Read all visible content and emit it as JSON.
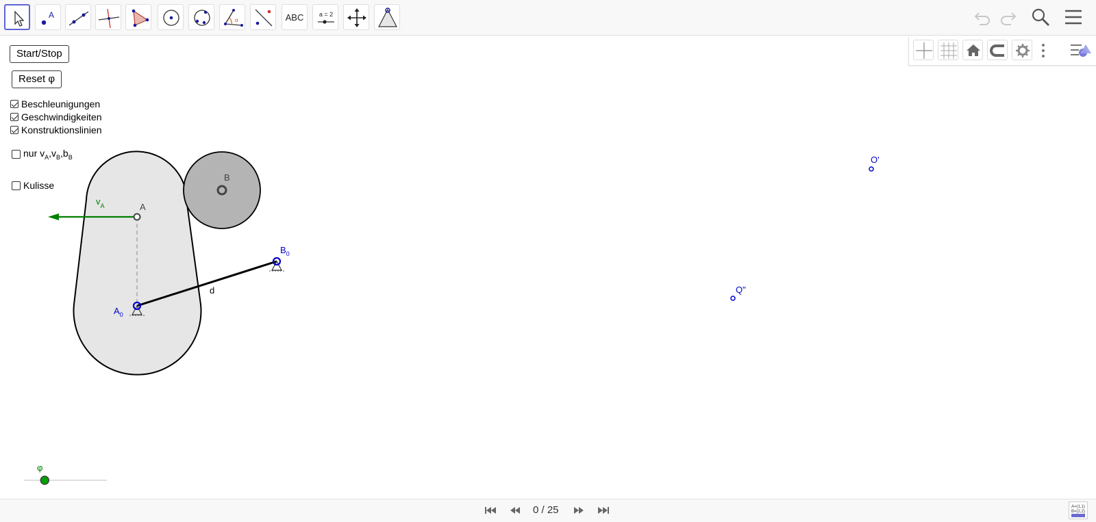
{
  "toolbar": {
    "tools": [
      {
        "name": "move-tool",
        "icon": "arrow-cursor-icon"
      },
      {
        "name": "point-tool",
        "icon": "point-icon",
        "label": "A"
      },
      {
        "name": "line-tool",
        "icon": "line-icon"
      },
      {
        "name": "perpendicular-tool",
        "icon": "perpendicular-icon"
      },
      {
        "name": "polygon-tool",
        "icon": "polygon-icon"
      },
      {
        "name": "circle-tool",
        "icon": "circle-center-icon"
      },
      {
        "name": "conic-tool",
        "icon": "circle-three-points-icon"
      },
      {
        "name": "angle-tool",
        "icon": "angle-icon",
        "label": "α"
      },
      {
        "name": "reflect-tool",
        "icon": "reflect-icon"
      },
      {
        "name": "text-tool",
        "icon": "text-icon",
        "label": "ABC"
      },
      {
        "name": "slider-tool",
        "icon": "slider-icon",
        "label": "a = 2"
      },
      {
        "name": "move-view-tool",
        "icon": "move-arrows-icon"
      },
      {
        "name": "custom-tool",
        "icon": "pyramid-icon"
      }
    ],
    "right_icons": [
      "undo-icon",
      "redo-icon",
      "search-icon",
      "menu-icon"
    ]
  },
  "stylebar": {
    "buttons": [
      "axes-icon",
      "grid-icon",
      "home-icon",
      "magnet-icon",
      "gear-icon",
      "more-icon",
      "view-menu-icon"
    ]
  },
  "controls": {
    "start_stop_label": "Start/Stop",
    "reset_label": "Reset φ",
    "checkboxes": [
      {
        "label": "Beschleunigungen",
        "checked": true
      },
      {
        "label": "Geschwindigkeiten",
        "checked": true
      },
      {
        "label": "Konstruktionslinien",
        "checked": true
      }
    ],
    "nur_prefix": "nur v",
    "nur_sub_a": "A",
    "nur_sub_b1": "B",
    "nur_sub_b2": "B",
    "nur_checked": false,
    "kulisse_label": "Kulisse",
    "kulisse_checked": false
  },
  "geometry": {
    "point_A": "A",
    "point_B": "B",
    "point_A0": "A",
    "point_A0_sub": "0",
    "point_B0": "B",
    "point_B0_sub": "0",
    "velocity_label": "v",
    "velocity_sub": "A",
    "segment_label": "d",
    "point_O": "O'",
    "point_Q": "Q\"",
    "slider_label": "φ",
    "slider_value_fraction": 0.25,
    "colors": {
      "body_fill": "#e6e6e6",
      "roller_fill": "#b4b4b4",
      "velocity": "#008000",
      "points_blue": "#0000cc",
      "slider_knob": "#00a000"
    }
  },
  "playback": {
    "counter": "0 / 25",
    "buttons": [
      "skip-back-icon",
      "rewind-icon",
      "fast-forward-icon",
      "skip-forward-icon"
    ]
  }
}
